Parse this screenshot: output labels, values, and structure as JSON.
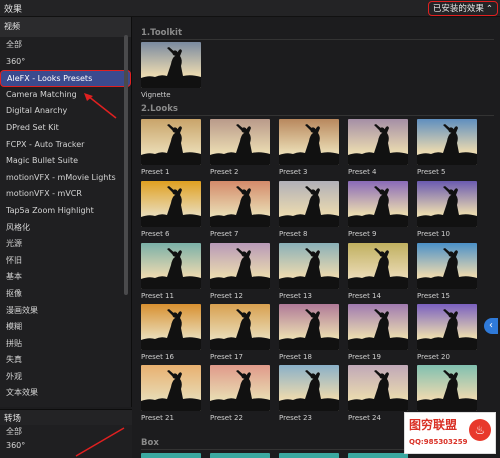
{
  "topbar": {
    "title": "效果",
    "dropdown_label": "已安装的效果",
    "dropdown_icon": "chevron-updown-icon"
  },
  "sidebar": {
    "header": "视频",
    "items": [
      {
        "label": "全部"
      },
      {
        "label": "360°"
      },
      {
        "label": "AleFX - Looks Presets",
        "selected": true
      },
      {
        "label": "Camera Matching"
      },
      {
        "label": "Digital Anarchy"
      },
      {
        "label": "DPred Set Kit"
      },
      {
        "label": "FCPX - Auto Tracker"
      },
      {
        "label": "Magic Bullet Suite"
      },
      {
        "label": "motionVFX - mMovie Lights"
      },
      {
        "label": "motionVFX - mVCR"
      },
      {
        "label": "Tap5a Zoom Highlight"
      },
      {
        "label": "风格化"
      },
      {
        "label": "光源"
      },
      {
        "label": "怀旧"
      },
      {
        "label": "基本"
      },
      {
        "label": "抠像"
      },
      {
        "label": "漫画效果"
      },
      {
        "label": "模糊"
      },
      {
        "label": "拼贴"
      },
      {
        "label": "失真"
      },
      {
        "label": "外观"
      },
      {
        "label": "文本效果"
      }
    ]
  },
  "transitions": {
    "title": "转场",
    "items": [
      {
        "label": "全部"
      },
      {
        "label": "360°"
      }
    ]
  },
  "content": {
    "sections": [
      {
        "title": "1.Toolkit"
      },
      {
        "title": "2.Looks"
      },
      {
        "title": "Box"
      }
    ],
    "toolkit_items": [
      {
        "label": "Vignette"
      }
    ],
    "looks_items": [
      {
        "label": "Preset 1",
        "color": "#c9a46a"
      },
      {
        "label": "Preset 2",
        "color": "#b99a8a"
      },
      {
        "label": "Preset 3",
        "color": "#b8885e"
      },
      {
        "label": "Preset 4",
        "color": "#a58fa6"
      },
      {
        "label": "Preset 5",
        "color": "#5f8fbf"
      },
      {
        "label": "Preset 6",
        "color": "#e0a020"
      },
      {
        "label": "Preset 7",
        "color": "#d48a6a"
      },
      {
        "label": "Preset 8",
        "color": "#b1b0b8"
      },
      {
        "label": "Preset 9",
        "color": "#8a6ab8"
      },
      {
        "label": "Preset 10",
        "color": "#6a5ab0"
      },
      {
        "label": "Preset 11",
        "color": "#7ab0a8"
      },
      {
        "label": "Preset 12",
        "color": "#b89ab8"
      },
      {
        "label": "Preset 13",
        "color": "#8ab0b8"
      },
      {
        "label": "Preset 14",
        "color": "#c0b060"
      },
      {
        "label": "Preset 15",
        "color": "#4a90c8"
      },
      {
        "label": "Preset 16",
        "color": "#d89030"
      },
      {
        "label": "Preset 17",
        "color": "#d8a050"
      },
      {
        "label": "Preset 18",
        "color": "#b07a98"
      },
      {
        "label": "Preset 19",
        "color": "#a07ab0"
      },
      {
        "label": "Preset 20",
        "color": "#7a60c0"
      },
      {
        "label": "Preset 21",
        "color": "#e8b070"
      },
      {
        "label": "Preset 22",
        "color": "#e09a8a"
      },
      {
        "label": "Preset 23",
        "color": "#8ab0c8"
      },
      {
        "label": "Preset 24",
        "color": "#c0a8b8"
      },
      {
        "label": "Preset 25",
        "color": "#80c0b0"
      }
    ],
    "box_thumb_color": "#3aa8a0"
  },
  "side_button_icon": "chevron-left-icon",
  "watermark": {
    "title": "图穷联盟",
    "subtitle": "QQ:985303259"
  },
  "colors": {
    "selection": "#3b4a8e",
    "highlight_border": "#e02020",
    "accent_blue": "#2f7ad9"
  }
}
